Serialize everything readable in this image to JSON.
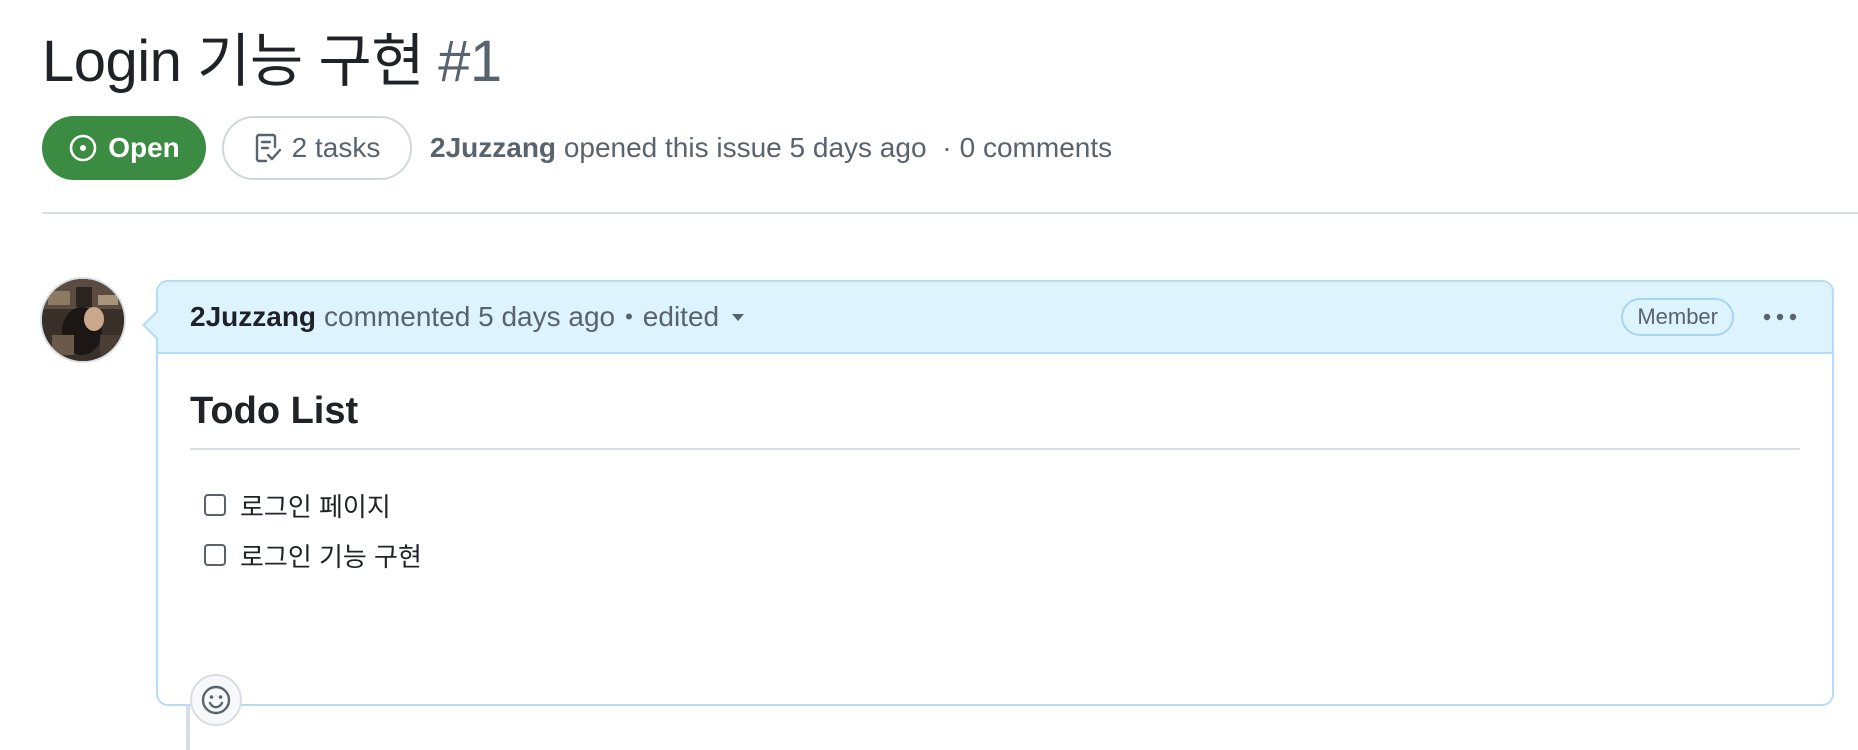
{
  "issue": {
    "title": "Login 기능 구현",
    "number": "#1",
    "state": "Open",
    "tasks_label": "2 tasks",
    "author": "2Juzzang",
    "opened_text": "opened this issue 5 days ago",
    "separator": "·",
    "comments_text": "0 comments"
  },
  "comment": {
    "author": "2Juzzang",
    "action_text": "commented 5 days ago",
    "dot": "•",
    "edited_label": "edited",
    "role_badge": "Member",
    "body": {
      "heading": "Todo List",
      "tasks": [
        {
          "label": "로그인 페이지",
          "checked": false
        },
        {
          "label": "로그인 기능 구현",
          "checked": false
        }
      ]
    }
  },
  "colors": {
    "open_state": "#3c8b42",
    "comment_header_bg": "#ddf4ff",
    "comment_border": "#b6dcf5",
    "muted_text": "#59636e"
  },
  "icons": {
    "state": "issue-opened-icon",
    "tasks": "checklist-icon",
    "edited": "triangle-down-icon",
    "more": "kebab-horizontal-icon",
    "reaction": "smiley-icon"
  }
}
